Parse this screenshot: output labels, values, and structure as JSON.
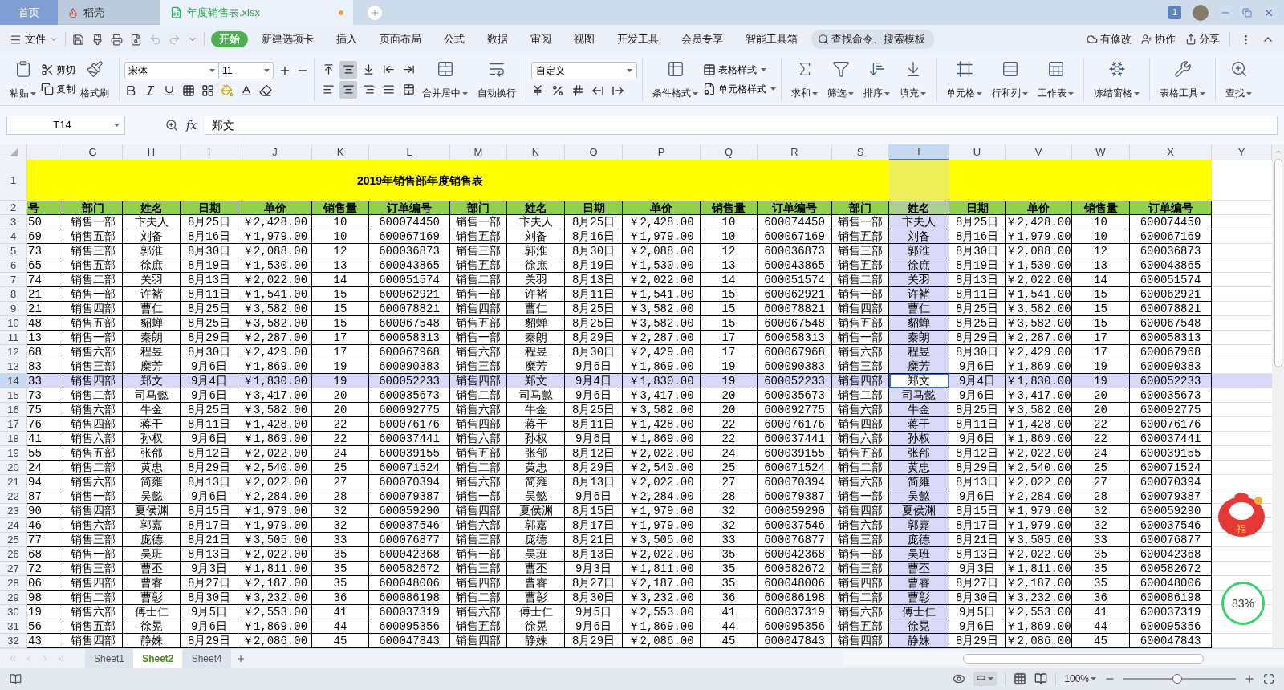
{
  "title_bar": {
    "tabs": [
      {
        "label": "首页",
        "kind": "home",
        "selected": false
      },
      {
        "label": "稻壳",
        "kind": "docer",
        "selected": false
      },
      {
        "label": "年度销售表.xlsx",
        "kind": "sheet",
        "selected": true,
        "unsaved": true
      }
    ],
    "badge": "1"
  },
  "menu_bar": {
    "file": "文件",
    "tabs": [
      {
        "label": "开始",
        "selected": true
      },
      {
        "label": "新建选项卡",
        "selected": false
      },
      {
        "label": "插入",
        "selected": false
      },
      {
        "label": "页面布局",
        "selected": false
      },
      {
        "label": "公式",
        "selected": false
      },
      {
        "label": "数据",
        "selected": false
      },
      {
        "label": "审阅",
        "selected": false
      },
      {
        "label": "视图",
        "selected": false
      },
      {
        "label": "开发工具",
        "selected": false
      },
      {
        "label": "会员专享",
        "selected": false
      },
      {
        "label": "智能工具箱",
        "selected": false
      }
    ],
    "search": {
      "placeholder": "查找命令、搜索模板"
    },
    "actions": [
      "有修改",
      "协作",
      "分享"
    ]
  },
  "ribbon": {
    "clipboard": {
      "paste": "粘贴",
      "cut": "剪切",
      "copy": "复制",
      "format_painter": "格式刷"
    },
    "font": {
      "name": "宋体",
      "size": "11"
    },
    "align_buttons": [
      {
        "selected": false
      },
      {
        "selected": true
      },
      {
        "selected": false
      },
      {
        "selected": false
      },
      {
        "selected": false
      },
      {
        "selected": false
      },
      {
        "selected": true
      },
      {
        "selected": false
      },
      {
        "selected": false
      },
      {
        "selected": false
      }
    ],
    "merge": "合并居中",
    "wrap": "自动换行",
    "number_format": "自定义",
    "conditional": "条件格式",
    "table_style": "表格样式",
    "cell_style": "单元格样式",
    "tools": [
      "求和",
      "筛选",
      "排序",
      "填充",
      "单元格",
      "行和列",
      "工作表",
      "冻结窗格",
      "表格工具",
      "查找"
    ]
  },
  "formula_bar": {
    "name_box": "T14",
    "fx": "fx",
    "value": "郑文"
  },
  "sheet": {
    "title": "2019年销售部年度销售表",
    "columns": [
      {
        "selected": false
      },
      {
        "letter": "G",
        "selected": false
      },
      {
        "letter": "H",
        "selected": false
      },
      {
        "letter": "I",
        "selected": false
      },
      {
        "letter": "J",
        "selected": false
      },
      {
        "letter": "K",
        "selected": false
      },
      {
        "letter": "L",
        "selected": false
      },
      {
        "letter": "M",
        "selected": false
      },
      {
        "letter": "N",
        "selected": false
      },
      {
        "letter": "O",
        "selected": false
      },
      {
        "letter": "P",
        "selected": false
      },
      {
        "letter": "Q",
        "selected": false
      },
      {
        "letter": "R",
        "selected": false
      },
      {
        "letter": "S",
        "selected": false
      },
      {
        "letter": "T",
        "selected": true
      },
      {
        "letter": "U",
        "selected": false
      },
      {
        "letter": "V",
        "selected": false
      },
      {
        "letter": "W",
        "selected": false
      },
      {
        "letter": "X",
        "selected": false
      },
      {
        "letter": "Y",
        "selected": false
      }
    ],
    "title_row": "1",
    "header_row": {
      "number": "2",
      "cells": [
        "号",
        "部门",
        "姓名",
        "日期",
        "单价",
        "销售量",
        "订单编号",
        "部门",
        "姓名",
        "日期",
        "单价",
        "销售量",
        "订单编号",
        "部门",
        "姓名",
        "日期",
        "单价",
        "销售量",
        "订单编号"
      ]
    },
    "rows": [
      {
        "number": "3",
        "selected": false,
        "cells": [
          "50",
          "销售一部",
          "卞夫人",
          "8月25日",
          "￥2,428.00",
          "10",
          "600074450",
          "销售一部",
          "卞夫人",
          "8月25日",
          "￥2,428.00",
          "10",
          "600074450",
          "销售一部",
          "卞夫人",
          "8月25日",
          "￥2,428.00",
          "10",
          "600074450"
        ]
      },
      {
        "number": "4",
        "selected": false,
        "cells": [
          "69",
          "销售五部",
          "刘备",
          "8月16日",
          "￥1,979.00",
          "10",
          "600067169",
          "销售五部",
          "刘备",
          "8月16日",
          "￥1,979.00",
          "10",
          "600067169",
          "销售五部",
          "刘备",
          "8月16日",
          "￥1,979.00",
          "10",
          "600067169"
        ]
      },
      {
        "number": "5",
        "selected": false,
        "cells": [
          "73",
          "销售三部",
          "郭淮",
          "8月30日",
          "￥2,088.00",
          "12",
          "600036873",
          "销售三部",
          "郭淮",
          "8月30日",
          "￥2,088.00",
          "12",
          "600036873",
          "销售三部",
          "郭淮",
          "8月30日",
          "￥2,088.00",
          "12",
          "600036873"
        ]
      },
      {
        "number": "6",
        "selected": false,
        "cells": [
          "65",
          "销售五部",
          "徐庶",
          "8月19日",
          "￥1,530.00",
          "13",
          "600043865",
          "销售五部",
          "徐庶",
          "8月19日",
          "￥1,530.00",
          "13",
          "600043865",
          "销售五部",
          "徐庶",
          "8月19日",
          "￥1,530.00",
          "13",
          "600043865"
        ]
      },
      {
        "number": "7",
        "selected": false,
        "cells": [
          "74",
          "销售二部",
          "关羽",
          "8月13日",
          "￥2,022.00",
          "14",
          "600051574",
          "销售二部",
          "关羽",
          "8月13日",
          "￥2,022.00",
          "14",
          "600051574",
          "销售二部",
          "关羽",
          "8月13日",
          "￥2,022.00",
          "14",
          "600051574"
        ]
      },
      {
        "number": "8",
        "selected": false,
        "cells": [
          "21",
          "销售一部",
          "许褚",
          "8月11日",
          "￥1,541.00",
          "15",
          "600062921",
          "销售一部",
          "许褚",
          "8月11日",
          "￥1,541.00",
          "15",
          "600062921",
          "销售一部",
          "许褚",
          "8月11日",
          "￥1,541.00",
          "15",
          "600062921"
        ]
      },
      {
        "number": "9",
        "selected": false,
        "cells": [
          "21",
          "销售四部",
          "曹仁",
          "8月25日",
          "￥3,582.00",
          "15",
          "600078821",
          "销售四部",
          "曹仁",
          "8月25日",
          "￥3,582.00",
          "15",
          "600078821",
          "销售四部",
          "曹仁",
          "8月25日",
          "￥3,582.00",
          "15",
          "600078821"
        ]
      },
      {
        "number": "10",
        "selected": false,
        "cells": [
          "48",
          "销售五部",
          "貂蝉",
          "8月25日",
          "￥3,582.00",
          "15",
          "600067548",
          "销售五部",
          "貂蝉",
          "8月25日",
          "￥3,582.00",
          "15",
          "600067548",
          "销售五部",
          "貂蝉",
          "8月25日",
          "￥3,582.00",
          "15",
          "600067548"
        ]
      },
      {
        "number": "11",
        "selected": false,
        "cells": [
          "13",
          "销售一部",
          "秦朗",
          "8月29日",
          "￥2,287.00",
          "17",
          "600058313",
          "销售一部",
          "秦朗",
          "8月29日",
          "￥2,287.00",
          "17",
          "600058313",
          "销售一部",
          "秦朗",
          "8月29日",
          "￥2,287.00",
          "17",
          "600058313"
        ]
      },
      {
        "number": "12",
        "selected": false,
        "cells": [
          "68",
          "销售六部",
          "程昱",
          "8月30日",
          "￥2,429.00",
          "17",
          "600067968",
          "销售六部",
          "程昱",
          "8月30日",
          "￥2,429.00",
          "17",
          "600067968",
          "销售六部",
          "程昱",
          "8月30日",
          "￥2,429.00",
          "17",
          "600067968"
        ]
      },
      {
        "number": "13",
        "selected": false,
        "cells": [
          "83",
          "销售三部",
          "糜芳",
          "9月6日",
          "￥1,869.00",
          "19",
          "600090383",
          "销售三部",
          "糜芳",
          "9月6日",
          "￥1,869.00",
          "19",
          "600090383",
          "销售三部",
          "糜芳",
          "9月6日",
          "￥1,869.00",
          "19",
          "600090383"
        ]
      },
      {
        "number": "14",
        "selected": true,
        "cells": [
          "33",
          "销售四部",
          "郑文",
          "9月4日",
          "￥1,830.00",
          "19",
          "600052233",
          "销售四部",
          "郑文",
          "9月4日",
          "￥1,830.00",
          "19",
          "600052233",
          "销售四部",
          "郑文",
          "9月4日",
          "￥1,830.00",
          "19",
          "600052233"
        ]
      },
      {
        "number": "15",
        "selected": false,
        "cells": [
          "73",
          "销售二部",
          "司马懿",
          "9月6日",
          "￥3,417.00",
          "20",
          "600035673",
          "销售二部",
          "司马懿",
          "9月6日",
          "￥3,417.00",
          "20",
          "600035673",
          "销售二部",
          "司马懿",
          "9月6日",
          "￥3,417.00",
          "20",
          "600035673"
        ]
      },
      {
        "number": "16",
        "selected": false,
        "cells": [
          "75",
          "销售六部",
          "牛金",
          "8月25日",
          "￥3,582.00",
          "20",
          "600092775",
          "销售六部",
          "牛金",
          "8月25日",
          "￥3,582.00",
          "20",
          "600092775",
          "销售六部",
          "牛金",
          "8月25日",
          "￥3,582.00",
          "20",
          "600092775"
        ]
      },
      {
        "number": "17",
        "selected": false,
        "cells": [
          "76",
          "销售四部",
          "蒋干",
          "8月11日",
          "￥1,428.00",
          "22",
          "600076176",
          "销售四部",
          "蒋干",
          "8月11日",
          "￥1,428.00",
          "22",
          "600076176",
          "销售四部",
          "蒋干",
          "8月11日",
          "￥1,428.00",
          "22",
          "600076176"
        ]
      },
      {
        "number": "18",
        "selected": false,
        "cells": [
          "41",
          "销售六部",
          "孙权",
          "9月6日",
          "￥1,869.00",
          "22",
          "600037441",
          "销售六部",
          "孙权",
          "9月6日",
          "￥1,869.00",
          "22",
          "600037441",
          "销售六部",
          "孙权",
          "9月6日",
          "￥1,869.00",
          "22",
          "600037441"
        ]
      },
      {
        "number": "19",
        "selected": false,
        "cells": [
          "55",
          "销售五部",
          "张郃",
          "8月12日",
          "￥2,022.00",
          "24",
          "600039155",
          "销售五部",
          "张郃",
          "8月12日",
          "￥2,022.00",
          "24",
          "600039155",
          "销售五部",
          "张郃",
          "8月12日",
          "￥2,022.00",
          "24",
          "600039155"
        ]
      },
      {
        "number": "20",
        "selected": false,
        "cells": [
          "24",
          "销售二部",
          "黄忠",
          "8月29日",
          "￥2,540.00",
          "25",
          "600071524",
          "销售二部",
          "黄忠",
          "8月29日",
          "￥2,540.00",
          "25",
          "600071524",
          "销售二部",
          "黄忠",
          "8月29日",
          "￥2,540.00",
          "25",
          "600071524"
        ]
      },
      {
        "number": "21",
        "selected": false,
        "cells": [
          "94",
          "销售六部",
          "简雍",
          "8月13日",
          "￥2,022.00",
          "27",
          "600070394",
          "销售六部",
          "简雍",
          "8月13日",
          "￥2,022.00",
          "27",
          "600070394",
          "销售六部",
          "简雍",
          "8月13日",
          "￥2,022.00",
          "27",
          "600070394"
        ]
      },
      {
        "number": "22",
        "selected": false,
        "cells": [
          "87",
          "销售一部",
          "吴懿",
          "9月6日",
          "￥2,284.00",
          "28",
          "600079387",
          "销售一部",
          "吴懿",
          "9月6日",
          "￥2,284.00",
          "28",
          "600079387",
          "销售一部",
          "吴懿",
          "9月6日",
          "￥2,284.00",
          "28",
          "600079387"
        ]
      },
      {
        "number": "23",
        "selected": false,
        "cells": [
          "90",
          "销售四部",
          "夏侯渊",
          "8月15日",
          "￥1,979.00",
          "32",
          "600059290",
          "销售四部",
          "夏侯渊",
          "8月15日",
          "￥1,979.00",
          "32",
          "600059290",
          "销售四部",
          "夏侯渊",
          "8月15日",
          "￥1,979.00",
          "32",
          "600059290"
        ]
      },
      {
        "number": "24",
        "selected": false,
        "cells": [
          "46",
          "销售六部",
          "郭嘉",
          "8月17日",
          "￥1,979.00",
          "32",
          "600037546",
          "销售六部",
          "郭嘉",
          "8月17日",
          "￥1,979.00",
          "32",
          "600037546",
          "销售六部",
          "郭嘉",
          "8月17日",
          "￥1,979.00",
          "32",
          "600037546"
        ]
      },
      {
        "number": "25",
        "selected": false,
        "cells": [
          "77",
          "销售三部",
          "庞德",
          "8月21日",
          "￥3,505.00",
          "33",
          "600076877",
          "销售三部",
          "庞德",
          "8月21日",
          "￥3,505.00",
          "33",
          "600076877",
          "销售三部",
          "庞德",
          "8月21日",
          "￥3,505.00",
          "33",
          "600076877"
        ]
      },
      {
        "number": "26",
        "selected": false,
        "cells": [
          "68",
          "销售一部",
          "吴班",
          "8月13日",
          "￥2,022.00",
          "35",
          "600042368",
          "销售一部",
          "吴班",
          "8月13日",
          "￥2,022.00",
          "35",
          "600042368",
          "销售一部",
          "吴班",
          "8月13日",
          "￥2,022.00",
          "35",
          "600042368"
        ]
      },
      {
        "number": "27",
        "selected": false,
        "cells": [
          "72",
          "销售三部",
          "曹丕",
          "9月3日",
          "￥1,811.00",
          "35",
          "600582672",
          "销售三部",
          "曹丕",
          "9月3日",
          "￥1,811.00",
          "35",
          "600582672",
          "销售三部",
          "曹丕",
          "9月3日",
          "￥1,811.00",
          "35",
          "600582672"
        ]
      },
      {
        "number": "28",
        "selected": false,
        "cells": [
          "06",
          "销售四部",
          "曹睿",
          "8月27日",
          "￥2,187.00",
          "35",
          "600048006",
          "销售四部",
          "曹睿",
          "8月27日",
          "￥2,187.00",
          "35",
          "600048006",
          "销售四部",
          "曹睿",
          "8月27日",
          "￥2,187.00",
          "35",
          "600048006"
        ]
      },
      {
        "number": "29",
        "selected": false,
        "cells": [
          "98",
          "销售二部",
          "曹彰",
          "8月30日",
          "￥3,232.00",
          "36",
          "600086198",
          "销售二部",
          "曹彰",
          "8月30日",
          "￥3,232.00",
          "36",
          "600086198",
          "销售二部",
          "曹彰",
          "8月30日",
          "￥3,232.00",
          "36",
          "600086198"
        ]
      },
      {
        "number": "30",
        "selected": false,
        "cells": [
          "19",
          "销售六部",
          "傅士仁",
          "9月5日",
          "￥2,553.00",
          "41",
          "600037319",
          "销售六部",
          "傅士仁",
          "9月5日",
          "￥2,553.00",
          "41",
          "600037319",
          "销售六部",
          "傅士仁",
          "9月5日",
          "￥2,553.00",
          "41",
          "600037319"
        ]
      },
      {
        "number": "31",
        "selected": false,
        "cells": [
          "56",
          "销售五部",
          "徐晃",
          "9月6日",
          "￥1,869.00",
          "44",
          "600095356",
          "销售五部",
          "徐晃",
          "9月6日",
          "￥1,869.00",
          "44",
          "600095356",
          "销售五部",
          "徐晃",
          "9月6日",
          "￥1,869.00",
          "44",
          "600095356"
        ]
      },
      {
        "number": "32",
        "selected": false,
        "cells": [
          "43",
          "销售四部",
          "静姝",
          "8月29日",
          "￥2,086.00",
          "45",
          "600047843",
          "销售四部",
          "静姝",
          "8月29日",
          "￥2,086.00",
          "45",
          "600047843",
          "销售四部",
          "静姝",
          "8月29日",
          "￥2,086.00",
          "45",
          "600047843"
        ]
      }
    ]
  },
  "sheet_tabs": [
    {
      "label": "Sheet1",
      "selected": false
    },
    {
      "label": "Sheet2",
      "selected": true
    },
    {
      "label": "Sheet4",
      "selected": false
    }
  ],
  "status_bar": {
    "input_mode": "中",
    "zoom": "100%",
    "zoom_slider": {
      "level": 0.48
    }
  },
  "overlays": {
    "pet_text": "福",
    "meter": "83%"
  }
}
